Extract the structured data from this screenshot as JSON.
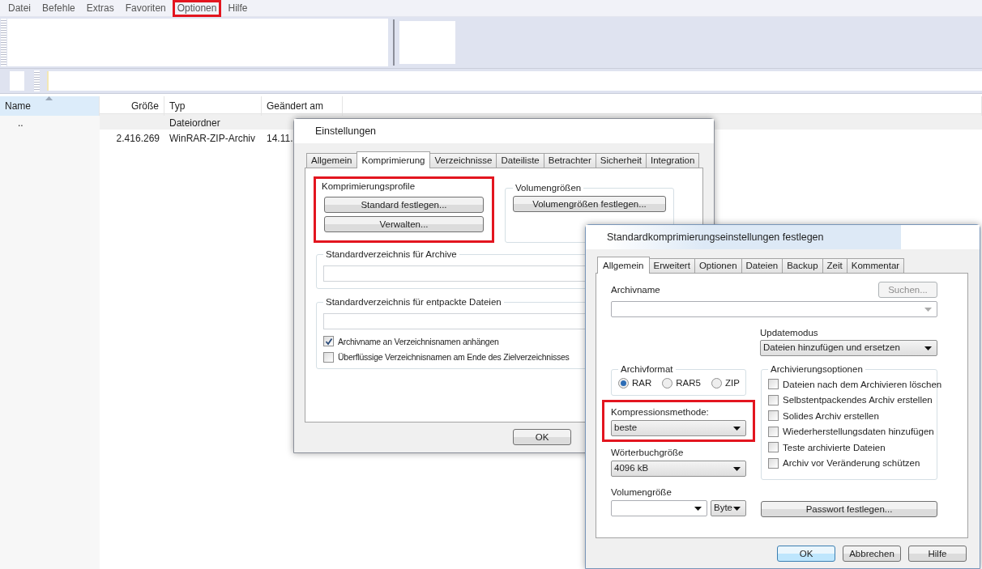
{
  "menu": [
    {
      "label": "Datei",
      "highlighted": false
    },
    {
      "label": "Befehle",
      "highlighted": false
    },
    {
      "label": "Extras",
      "highlighted": false
    },
    {
      "label": "Favoriten",
      "highlighted": false
    },
    {
      "label": "Optionen",
      "highlighted": true
    },
    {
      "label": "Hilfe",
      "highlighted": false
    }
  ],
  "file_list": {
    "columns": [
      {
        "label": "Name",
        "sorted": true
      },
      {
        "label": "Größe",
        "sorted": false
      },
      {
        "label": "Typ",
        "sorted": false
      },
      {
        "label": "Geändert am",
        "sorted": false
      }
    ],
    "rows": [
      {
        "selected": true,
        "name": "..",
        "type": "Dateiordner"
      },
      {
        "selected": false,
        "size": "2.416.269",
        "type": "WinRAR-ZIP-Archiv",
        "modified": "14.11."
      }
    ]
  },
  "settings_dialog": {
    "title": "Einstellungen",
    "tabs": [
      {
        "label": "Allgemein",
        "selected": false
      },
      {
        "label": "Komprimierung",
        "selected": true
      },
      {
        "label": "Verzeichnisse",
        "selected": false
      },
      {
        "label": "Dateiliste",
        "selected": false
      },
      {
        "label": "Betrachter",
        "selected": false
      },
      {
        "label": "Sicherheit",
        "selected": false
      },
      {
        "label": "Integration",
        "selected": false
      }
    ],
    "profiles_group": {
      "title": "Komprimierungsprofile",
      "highlighted": true,
      "buttons": [
        "Standard festlegen...",
        "Verwalten..."
      ]
    },
    "volume_group": {
      "title": "Volumengrößen",
      "button": "Volumengrößen festlegen..."
    },
    "archive_dir_group": {
      "title": "Standardverzeichnis für Archive"
    },
    "extract_dir_group": {
      "title": "Standardverzeichnis für entpackte Dateien",
      "options": [
        {
          "label": "Archivname an Verzeichnisnamen anhängen",
          "checked": true
        },
        {
          "label": "Überflüssige Verzeichnisnamen am Ende des Zielverzeichnisses",
          "checked": false
        }
      ]
    },
    "buttons": [
      "OK"
    ]
  },
  "profile_dialog": {
    "title": "Standardkomprimierungseinstellungen festlegen",
    "tabs": [
      {
        "label": "Allgemein",
        "selected": true
      },
      {
        "label": "Erweitert",
        "selected": false
      },
      {
        "label": "Optionen",
        "selected": false
      },
      {
        "label": "Dateien",
        "selected": false
      },
      {
        "label": "Backup",
        "selected": false
      },
      {
        "label": "Zeit",
        "selected": false
      },
      {
        "label": "Kommentar",
        "selected": false
      }
    ],
    "archive_name": {
      "label": "Archivname",
      "browse_button": {
        "label": "Suchen...",
        "disabled": true
      }
    },
    "update_mode": {
      "label": "Updatemodus",
      "value": "Dateien hinzufügen und ersetzen"
    },
    "archive_format": {
      "title": "Archivformat",
      "options": [
        {
          "label": "RAR",
          "selected": true
        },
        {
          "label": "RAR5",
          "selected": false
        },
        {
          "label": "ZIP",
          "selected": false
        }
      ]
    },
    "compression_method": {
      "label": "Kompressionsmethode:",
      "value": "beste",
      "highlighted": true
    },
    "dictionary_size": {
      "label": "Wörterbuchgröße",
      "value": "4096 kB"
    },
    "volume_size": {
      "label": "Volumengröße",
      "unit": "Byte"
    },
    "archive_options": {
      "title": "Archivierungsoptionen",
      "options": [
        {
          "label": "Dateien nach dem Archivieren löschen",
          "checked": false
        },
        {
          "label": "Selbstentpackendes Archiv erstellen",
          "checked": false
        },
        {
          "label": "Solides Archiv erstellen",
          "checked": false
        },
        {
          "label": "Wiederherstellungsdaten hinzufügen",
          "checked": false
        },
        {
          "label": "Teste archivierte Dateien",
          "checked": false
        },
        {
          "label": "Archiv vor Veränderung schützen",
          "checked": false
        }
      ]
    },
    "password_button": "Passwort festlegen...",
    "buttons": [
      {
        "label": "OK",
        "default": true
      },
      {
        "label": "Abbrechen",
        "default": false
      },
      {
        "label": "Hilfe",
        "default": false
      }
    ]
  }
}
